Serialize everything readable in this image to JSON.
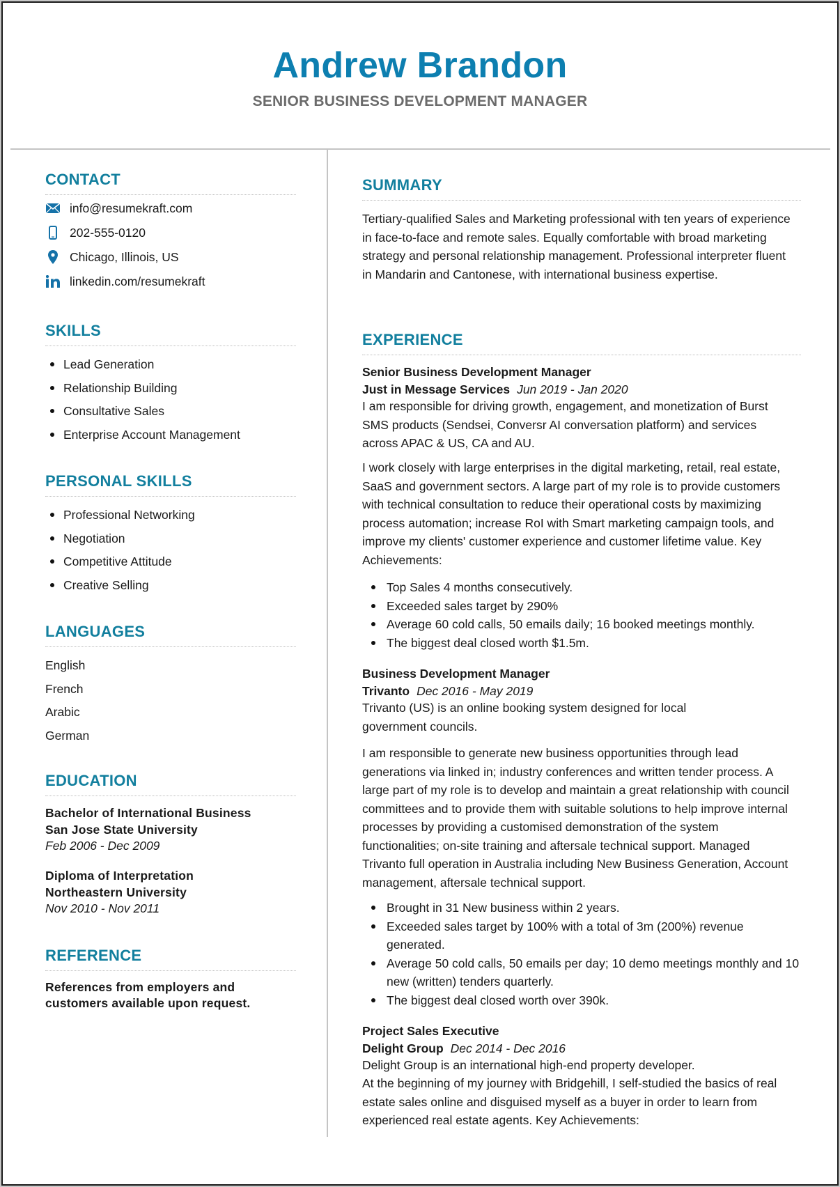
{
  "header": {
    "name": "Andrew Brandon",
    "title": "SENIOR BUSINESS DEVELOPMENT MANAGER"
  },
  "colors": {
    "accent": "#127f9e",
    "name": "#0d7fb0",
    "subtitle": "#6b6b6b",
    "rule": "#c4c4c4"
  },
  "contact": {
    "heading": "CONTACT",
    "items": [
      {
        "icon": "envelope-icon",
        "text": "info@resumekraft.com"
      },
      {
        "icon": "phone-icon",
        "text": "202-555-0120"
      },
      {
        "icon": "location-pin-icon",
        "text": "Chicago, Illinois, US"
      },
      {
        "icon": "linkedin-icon",
        "text": "linkedin.com/resumekraft"
      }
    ]
  },
  "skills": {
    "heading": "SKILLS",
    "items": [
      "Lead Generation",
      "Relationship Building",
      "Consultative Sales",
      "Enterprise Account Management"
    ]
  },
  "personal_skills": {
    "heading": "PERSONAL SKILLS",
    "items": [
      "Professional Networking",
      "Negotiation",
      "Competitive Attitude",
      "Creative Selling"
    ]
  },
  "languages": {
    "heading": "LANGUAGES",
    "items": [
      "English",
      "French",
      "Arabic",
      "German"
    ]
  },
  "education": {
    "heading": "EDUCATION",
    "items": [
      {
        "degree": "Bachelor of International Business",
        "school": "San Jose State University",
        "dates": "Feb 2006 - Dec 2009"
      },
      {
        "degree": "Diploma of Interpretation",
        "school": "Northeastern University",
        "dates": "Nov 2010 - Nov 2011"
      }
    ]
  },
  "reference": {
    "heading": "REFERENCE",
    "line1": "References from employers and",
    "line2": "customers available upon request."
  },
  "summary": {
    "heading": "SUMMARY",
    "text": "Tertiary-qualified Sales and Marketing professional with ten years of experience in face-to-face and remote sales. Equally comfortable with broad marketing strategy and personal relationship management. Professional interpreter fluent in Mandarin and Cantonese, with international business expertise."
  },
  "experience": {
    "heading": "EXPERIENCE",
    "jobs": [
      {
        "title": "Senior Business Development Manager",
        "company": "Just in Message Services",
        "dates": "Jun 2019 - Jan 2020",
        "paragraphs": [
          "I am responsible for driving growth, engagement, and monetization of Burst SMS products (Sendsei, Conversr AI conversation platform) and services across APAC & US, CA and AU.",
          "I work closely with large enterprises in the digital marketing, retail, real estate, SaaS and government sectors. A large part of my role is to provide customers with technical consultation to reduce their operational costs by maximizing process automation; increase RoI with Smart marketing campaign tools, and improve my clients' customer experience and customer lifetime value. Key Achievements:"
        ],
        "achievements": [
          "Top Sales 4 months consecutively.",
          "Exceeded sales target by 290%",
          "Average 60 cold calls, 50 emails daily; 16 booked meetings monthly.",
          "The biggest deal closed worth $1.5m."
        ]
      },
      {
        "title": "Business Development Manager",
        "company": "Trivanto",
        "dates": "Dec 2016 - May 2019",
        "paragraphs": [
          "Trivanto (US) is an online booking system designed for local government councils.",
          "I am responsible to generate new business opportunities through lead generations via linked in; industry conferences and written tender process. A large part of my role is to develop and maintain a great relationship with council committees and to provide them with suitable solutions to help improve internal processes by providing a customised demonstration of the system functionalities; on-site training and aftersale technical support. Managed Trivanto full operation in Australia including New Business Generation, Account management, aftersale technical support."
        ],
        "achievements": [
          "Brought in 31 New business within 2 years.",
          "Exceeded sales target by 100% with a total of 3m  (200%) revenue generated.",
          "Average 50 cold calls, 50 emails per day; 10 demo meetings monthly and 10 new (written) tenders quarterly.",
          "The biggest deal closed worth over 390k."
        ]
      },
      {
        "title": "Project Sales Executive",
        "company": "Delight Group",
        "dates": "Dec 2014 - Dec 2016",
        "paragraphs": [
          "Delight Group is an international high-end property developer.",
          "At the beginning of my journey with Bridgehill, I self-studied the basics of real estate sales online and disguised myself as a buyer in order to learn from experienced real estate agents. Key Achievements:"
        ],
        "achievements": []
      }
    ]
  }
}
